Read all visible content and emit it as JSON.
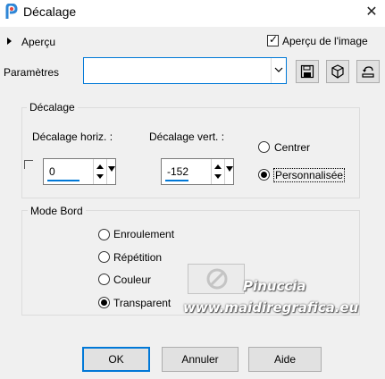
{
  "window": {
    "title": "Décalage",
    "close_glyph": "✕"
  },
  "preview": {
    "toggle_label": "Aperçu",
    "checkbox_label": "Aperçu de l'image",
    "checkbox_checked": true
  },
  "presets": {
    "label": "Paramètres",
    "value": ""
  },
  "offset_group": {
    "title": "Décalage",
    "horiz_label": "Décalage horiz. :",
    "horiz_value": "0",
    "vert_label": "Décalage vert. :",
    "vert_value": "-152",
    "radio_center": "Centrer",
    "radio_custom": "Personnalisée",
    "selected": "Personnalisée"
  },
  "edge_group": {
    "title": "Mode Bord",
    "options": [
      "Enroulement",
      "Répétition",
      "Couleur",
      "Transparent"
    ],
    "selected": "Transparent"
  },
  "buttons": {
    "ok": "OK",
    "cancel": "Annuler",
    "help": "Aide"
  },
  "watermark": {
    "line1": "Pinuccia",
    "line2": "www.maidiregrafica.eu"
  },
  "colors": {
    "accent": "#0078d7",
    "background": "#f0f0f0",
    "icon_blue": "#2e86d6",
    "icon_red": "#e8453c"
  }
}
